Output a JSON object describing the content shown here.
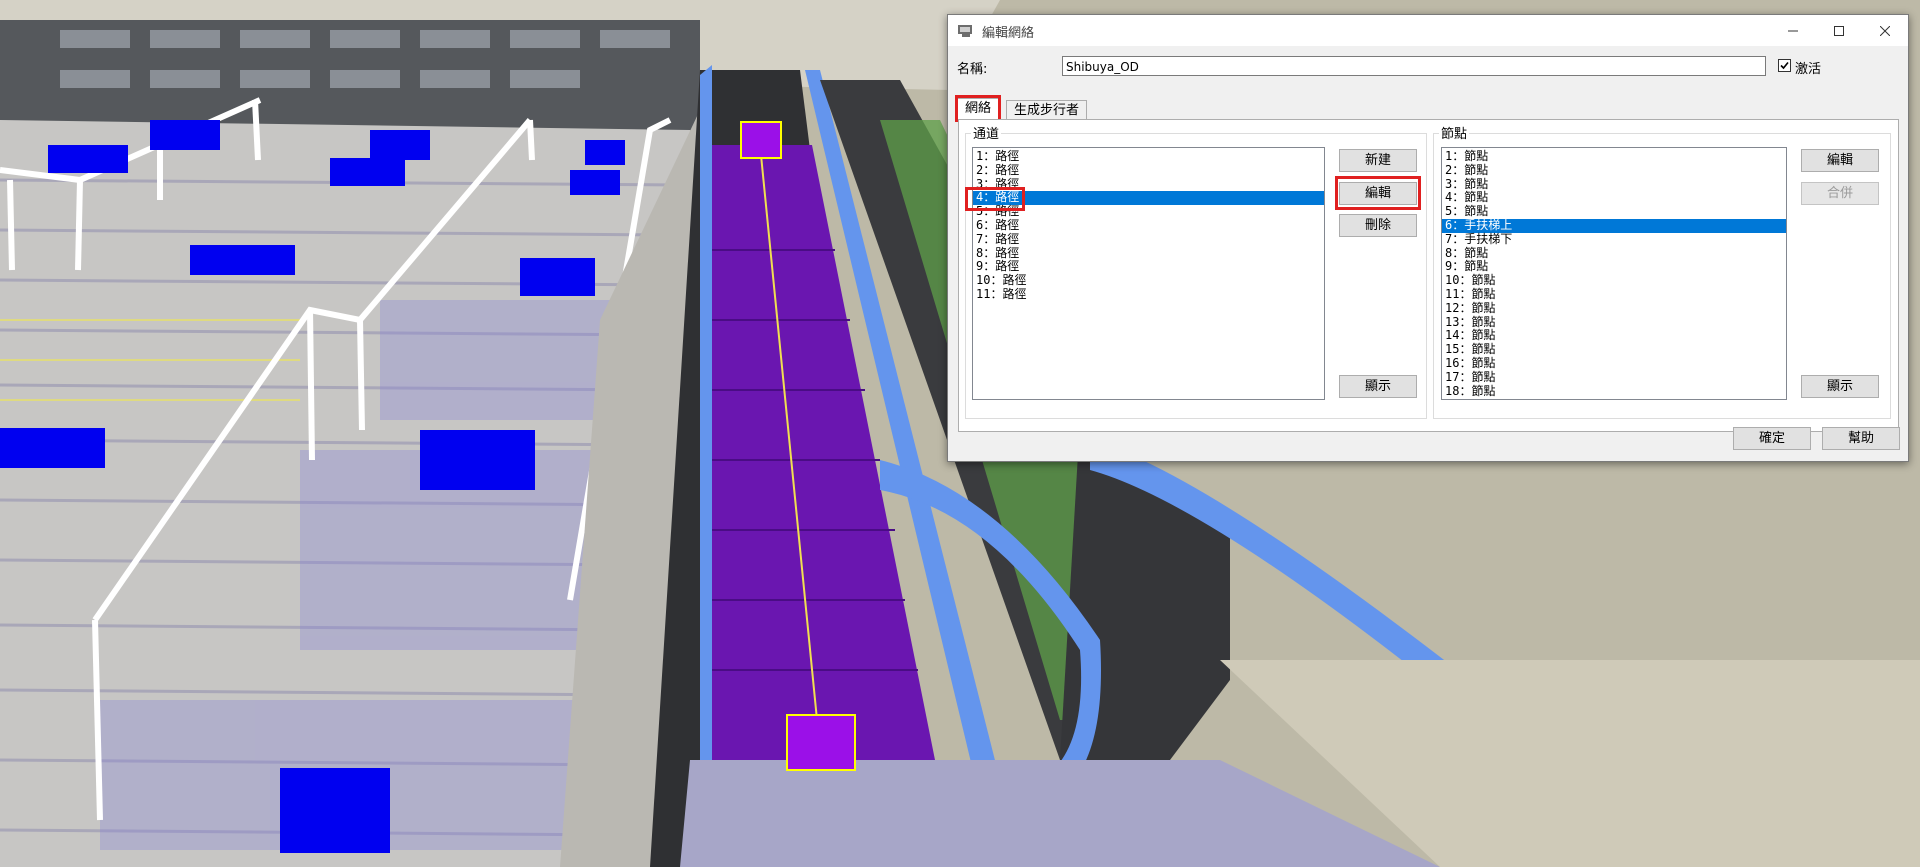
{
  "dialog": {
    "title": "編輯網絡",
    "name_label": "名稱:",
    "name_value": "Shibuya_OD",
    "active_label": "激活",
    "tabs": [
      "網絡",
      "生成步行者"
    ],
    "channels": {
      "title": "通道",
      "items": [
        "1：路徑",
        "2：路徑",
        "3：路徑",
        "4：路徑",
        "5：路徑",
        "6：路徑",
        "7：路徑",
        "8：路徑",
        "9：路徑",
        "10：路徑",
        "11：路徑"
      ],
      "selected_index": 3
    },
    "channel_buttons": {
      "new": "新建",
      "edit": "編輯",
      "delete": "刪除",
      "show": "顯示"
    },
    "nodes": {
      "title": "節點",
      "items": [
        "1：節點",
        "2：節點",
        "3：節點",
        "4：節點",
        "5：節點",
        "6：手扶梯上",
        "7：手扶梯下",
        "8：節點",
        "9：節點",
        "10：節點",
        "11：節點",
        "12：節點",
        "13：節點",
        "14：節點",
        "15：節點",
        "16：節點",
        "17：節點",
        "18：節點"
      ],
      "selected_index": 5
    },
    "node_buttons": {
      "edit": "編輯",
      "merge": "合併",
      "show": "顯示"
    },
    "ok": "確定",
    "help": "幫助"
  },
  "colors": {
    "selection": "#0078d7",
    "highlight": "#e02020",
    "agent": "#0000ff",
    "escalator_path": "#7a22d0",
    "escalator_rail": "#6495ed"
  }
}
